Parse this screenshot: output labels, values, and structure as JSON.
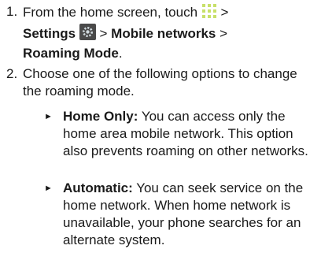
{
  "steps": [
    {
      "number": "1.",
      "text_pre": "From the home screen, touch",
      "gt1": " >",
      "settings_label": "Settings",
      "gt2": " > ",
      "mobile_networks": "Mobile networks",
      "gt3": " >",
      "roaming_mode": "Roaming Mode",
      "period": ".",
      "apps_icon": "apps-grid-icon",
      "settings_icon": "settings-gear-icon"
    },
    {
      "number": "2.",
      "text": "Choose one of the following options to change the roaming mode."
    }
  ],
  "options": [
    {
      "marker": "►",
      "title": "Home Only:",
      "body": " You can access only the home area mobile network. This option also prevents roaming on other networks."
    },
    {
      "marker": "►",
      "title": "Automatic:",
      "body": " You can seek service on the home network. When home network is unavailable, your phone searches for an alternate system."
    }
  ],
  "colors": {
    "apps_icon": "#c8e06a",
    "settings_icon_bg": "#4a4a4a",
    "text": "#1a1a1a"
  }
}
